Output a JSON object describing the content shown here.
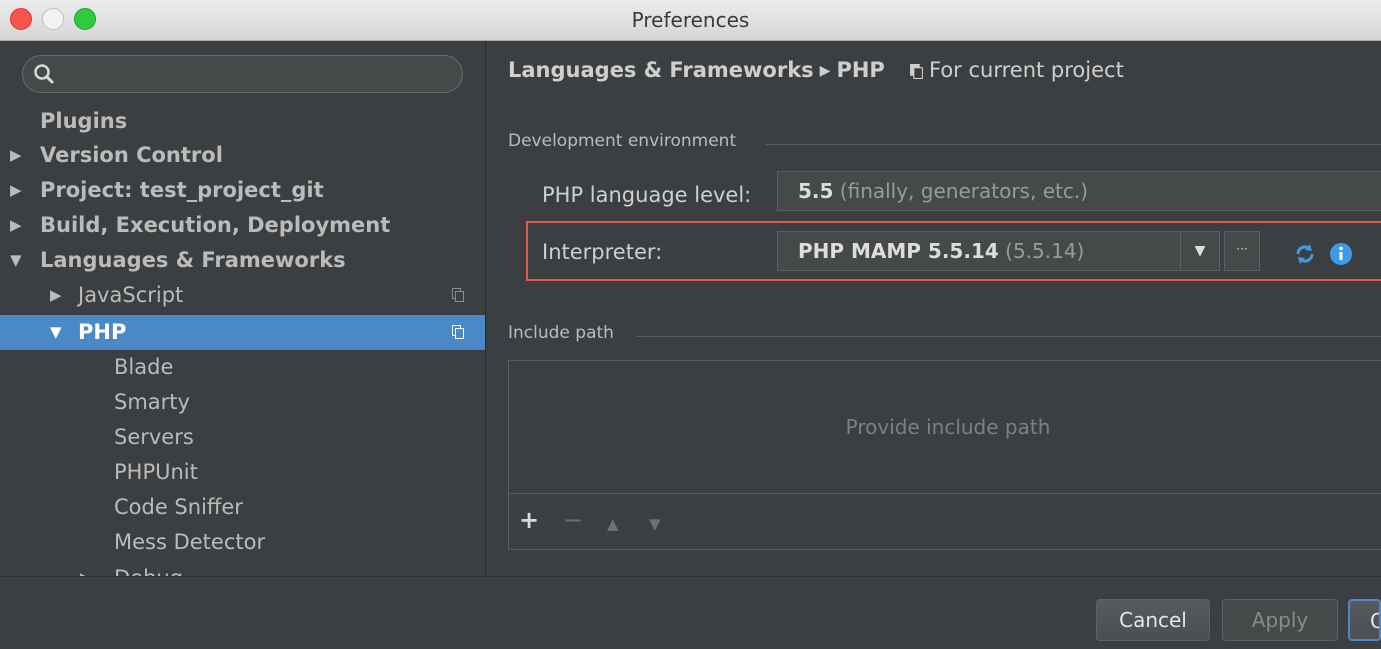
{
  "window": {
    "title": "Preferences"
  },
  "search": {
    "placeholder": ""
  },
  "sidebar": {
    "items": [
      {
        "label": "Plugins"
      },
      {
        "label": "Version Control"
      },
      {
        "label": "Project: test_project_git"
      },
      {
        "label": "Build, Execution, Deployment"
      },
      {
        "label": "Languages & Frameworks"
      },
      {
        "label": "JavaScript"
      },
      {
        "label": "PHP"
      },
      {
        "label": "Blade"
      },
      {
        "label": "Smarty"
      },
      {
        "label": "Servers"
      },
      {
        "label": "PHPUnit"
      },
      {
        "label": "Code Sniffer"
      },
      {
        "label": "Mess Detector"
      },
      {
        "label": "Debug"
      }
    ]
  },
  "header": {
    "breadcrumb_section": "Languages & Frameworks",
    "breadcrumb_separator": "▶",
    "breadcrumb_page": "PHP",
    "scope_label": "For current project"
  },
  "dev_env": {
    "title": "Development environment",
    "language_level_label": "PHP language level:",
    "language_level_value": "5.5",
    "language_level_desc": "(finally, generators, etc.)",
    "interpreter_label": "Interpreter:",
    "interpreter_value": "PHP MAMP 5.5.14",
    "interpreter_version": "(5.5.14)",
    "browse_label": "···"
  },
  "include_path": {
    "title": "Include path",
    "placeholder": "Provide include path",
    "add": "+",
    "remove": "−",
    "up": "▲",
    "down": "▼"
  },
  "footer": {
    "cancel": "Cancel",
    "apply": "Apply",
    "ok": "OK"
  },
  "colors": {
    "background": "#3c3f41",
    "selection": "#4a88c7",
    "highlight_border": "#e05a4f",
    "accent": "#3d9be9"
  }
}
